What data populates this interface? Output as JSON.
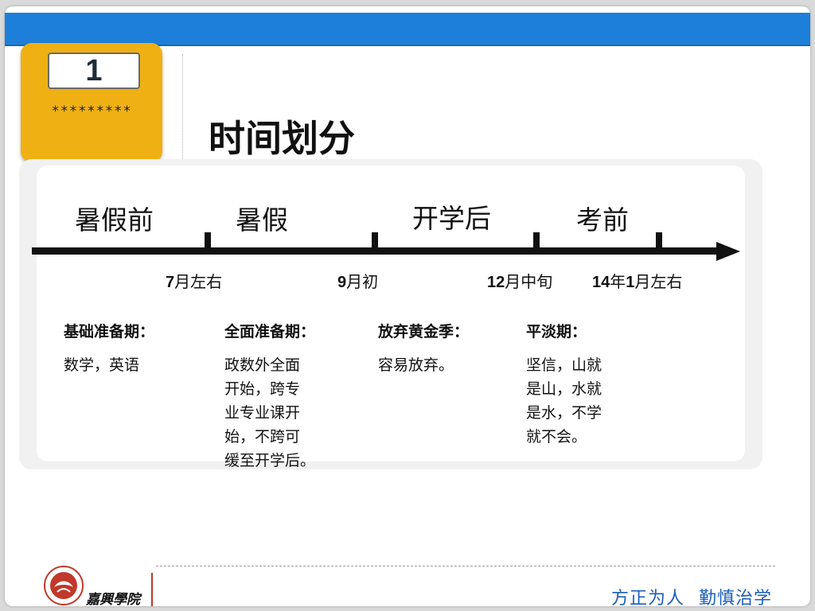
{
  "badge": {
    "number": "1",
    "stars": "*********"
  },
  "title": "时间划分",
  "timeline": {
    "phases": [
      "暑假前",
      "暑假",
      "开学后",
      "考前"
    ],
    "dates": [
      {
        "num": "7",
        "text": "月左右"
      },
      {
        "num": "9",
        "text": "月初"
      },
      {
        "num": "12",
        "text": "月中旬"
      },
      {
        "num": "14",
        "text": "年",
        "num2": "1",
        "text2": "月左右"
      }
    ]
  },
  "columns": [
    {
      "heading": "基础准备期：",
      "lines": [
        "数学，英语"
      ]
    },
    {
      "heading": "全面准备期：",
      "lines": [
        "政数外全面",
        "开始，跨专",
        "业专业课开",
        "始，不跨可",
        "缓至开学后。"
      ]
    },
    {
      "heading": "放弃黄金季：",
      "lines": [
        "容易放弃。"
      ]
    },
    {
      "heading": "平淡期：",
      "lines": [
        "坚信，山就",
        "是山，水就",
        "是水，不学",
        "就不会。"
      ]
    }
  ],
  "footer": {
    "logo_text": "嘉興學院",
    "motto_part1": "方正为人",
    "motto_part2": "勤慎治学"
  },
  "colors": {
    "top_bar": "#1d7fd9",
    "badge": "#efb013",
    "motto": "#1b5fb8"
  }
}
